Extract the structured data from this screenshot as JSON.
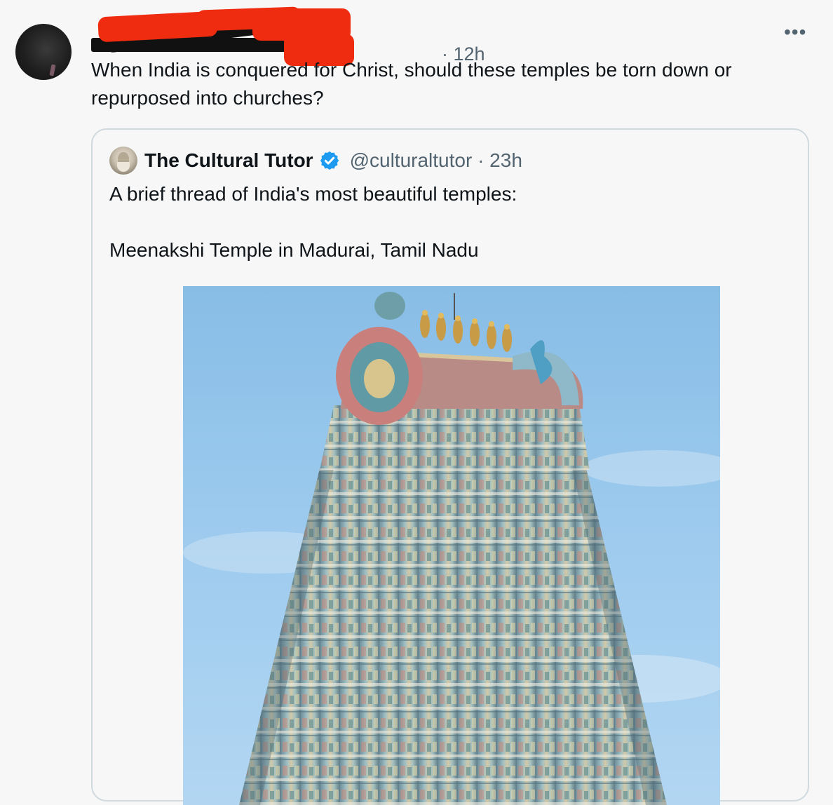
{
  "post": {
    "time": "12h",
    "separator": "·",
    "text": "When India is conquered for Christ, should these temples be torn down or repurposed into churches?",
    "more_icon": "more-horizontal-icon"
  },
  "quote": {
    "name": "The Cultural Tutor",
    "verified_icon": "verified-badge-icon",
    "handle_time": "@culturaltutor · 23h",
    "line1": "A brief thread of India's most beautiful temples:",
    "line2": "Meenakshi Temple in Madurai, Tamil Nadu",
    "image_alt": "Meenakshi Temple gopuram"
  },
  "colors": {
    "background": "#f7f7f7",
    "text_primary": "#0f1419",
    "text_secondary": "#536471",
    "verified_blue": "#1d9bf0",
    "border": "#cfd9de",
    "redaction_red": "#f02c10"
  }
}
